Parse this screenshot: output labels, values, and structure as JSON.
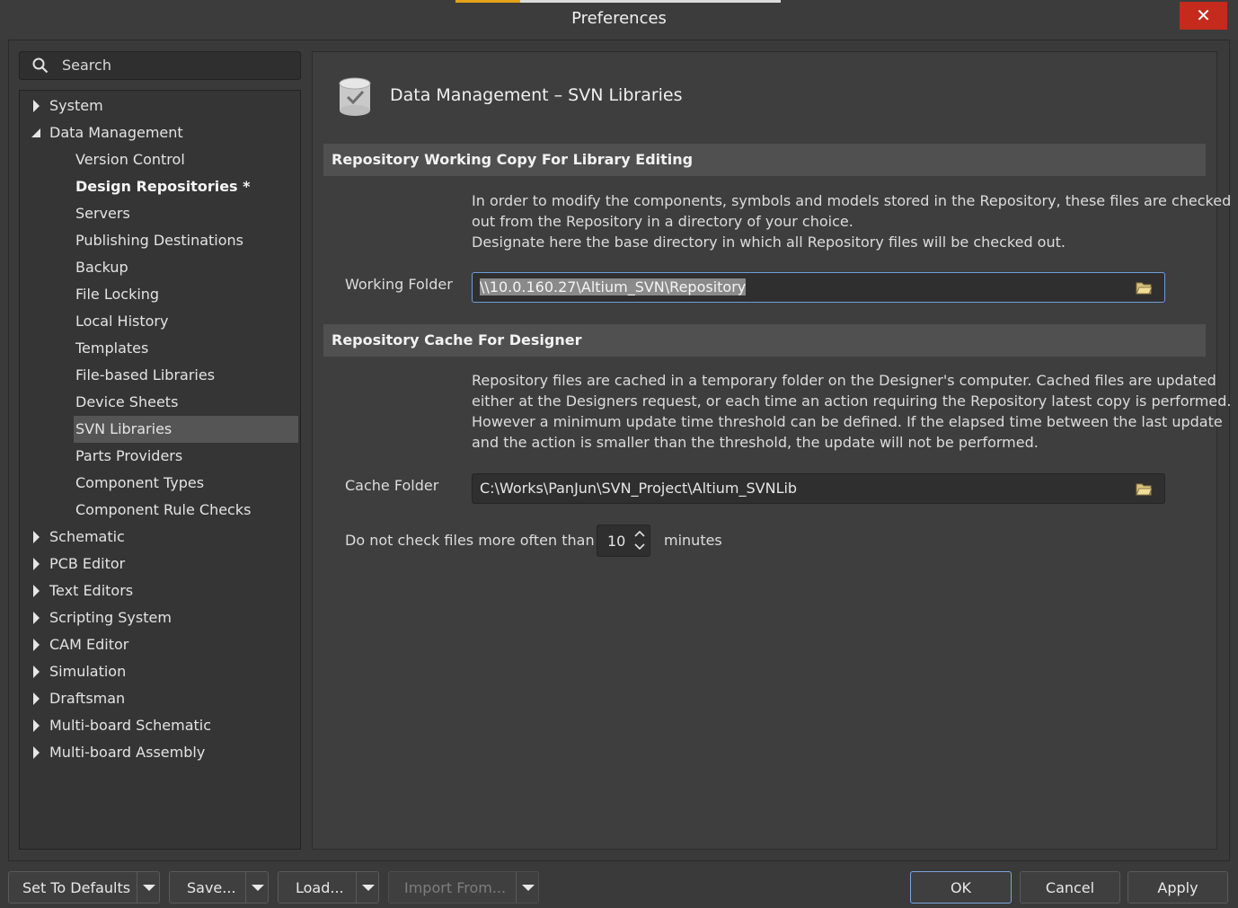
{
  "window": {
    "title": "Preferences",
    "close_glyph": "✕",
    "colors": {
      "close_bg": "#c42b1c",
      "accent_orange": "#e3a21a"
    }
  },
  "search": {
    "label": "Search",
    "icon": "search-icon"
  },
  "tree": {
    "system": "System",
    "data_management": "Data Management",
    "dm_children": {
      "version_control": "Version Control",
      "design_repositories": "Design Repositories *",
      "servers": "Servers",
      "publishing_destinations": "Publishing Destinations",
      "backup": "Backup",
      "file_locking": "File Locking",
      "local_history": "Local History",
      "templates": "Templates",
      "file_based_libraries": "File-based Libraries",
      "device_sheets": "Device Sheets",
      "svn_libraries": "SVN Libraries",
      "parts_providers": "Parts Providers",
      "component_types": "Component Types",
      "component_rule_checks": "Component Rule Checks"
    },
    "schematic": "Schematic",
    "pcb_editor": "PCB Editor",
    "text_editors": "Text Editors",
    "scripting_system": "Scripting System",
    "cam_editor": "CAM Editor",
    "simulation": "Simulation",
    "draftsman": "Draftsman",
    "multiboard_schematic": "Multi-board Schematic",
    "multiboard_assembly": "Multi-board Assembly"
  },
  "page": {
    "title": "Data Management – SVN Libraries",
    "icon": "database-check-icon",
    "section1": {
      "heading": "Repository Working Copy For Library Editing",
      "lines": [
        "In order to modify the components, symbols and models stored in the Repository, these files are checked",
        "out from the Repository in a directory of your choice.",
        "Designate here the base directory in which all Repository files will be checked out."
      ],
      "working_folder_label": "Working Folder",
      "working_folder_value": "\\\\10.0.160.27\\Altium_SVN\\Repository"
    },
    "section2": {
      "heading": "Repository Cache For Designer",
      "lines": [
        "Repository files are cached in a temporary folder on the Designer's computer. Cached files are updated",
        "either at the Designers request, or each time an action requiring the Repository latest copy is performed.",
        "However a minimum update time threshold can be defined. If the elapsed time between the last update",
        "and the action is smaller than the threshold, the update will not be performed."
      ],
      "cache_folder_label": "Cache Folder",
      "cache_folder_value": "C:\\Works\\PanJun\\SVN_Project\\Altium_SVNLib",
      "check_label": "Do not check files more often than",
      "check_value": "10",
      "check_unit": "minutes"
    }
  },
  "buttons": {
    "set_to_defaults": "Set To Defaults",
    "save": "Save...",
    "load": "Load...",
    "import_from": "Import From...",
    "ok": "OK",
    "cancel": "Cancel",
    "apply": "Apply"
  }
}
